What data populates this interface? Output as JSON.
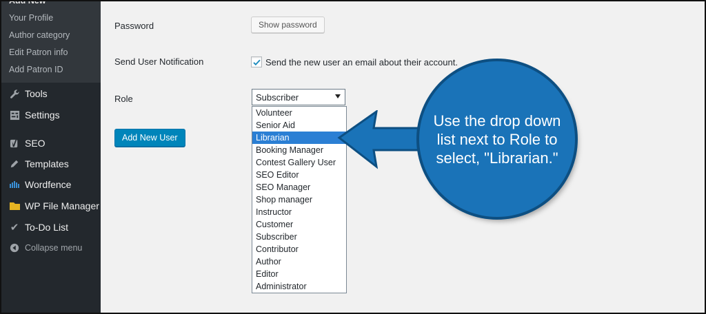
{
  "sidebar": {
    "submenu": [
      "Add New",
      "Your Profile",
      "Author category",
      "Edit Patron info",
      "Add Patron ID"
    ],
    "menu": [
      {
        "label": "Tools",
        "icon": "wrench-icon"
      },
      {
        "label": "Settings",
        "icon": "settings-icon"
      },
      {
        "label": "SEO",
        "icon": "yoast-icon"
      },
      {
        "label": "Templates",
        "icon": "pencil-icon"
      },
      {
        "label": "Wordfence",
        "icon": "wordfence-icon"
      },
      {
        "label": "WP File Manager",
        "icon": "folder-icon"
      },
      {
        "label": "To-Do List",
        "icon": "checkmark-icon"
      }
    ],
    "collapse": "Collapse menu"
  },
  "form": {
    "password_label": "Password",
    "show_password": "Show password",
    "notification_label": "Send User Notification",
    "notification_text": "Send the new user an email about their account.",
    "notification_checked": true,
    "role_label": "Role",
    "role_value": "Subscriber",
    "role_options": [
      "Volunteer",
      "Senior Aid",
      "Librarian",
      "Booking Manager",
      "Contest Gallery User",
      "SEO Editor",
      "SEO Manager",
      "Shop manager",
      "Instructor",
      "Customer",
      "Subscriber",
      "Contributor",
      "Author",
      "Editor",
      "Administrator"
    ],
    "highlighted_option": "Librarian",
    "submit": "Add New User"
  },
  "callout": {
    "text": "Use the drop down list next to Role to select, \"Librarian.\""
  },
  "colors": {
    "sidebar_bg": "#23282d",
    "primary_button": "#0085ba",
    "callout": "#1a73b8",
    "highlight": "#2b7fd4"
  }
}
